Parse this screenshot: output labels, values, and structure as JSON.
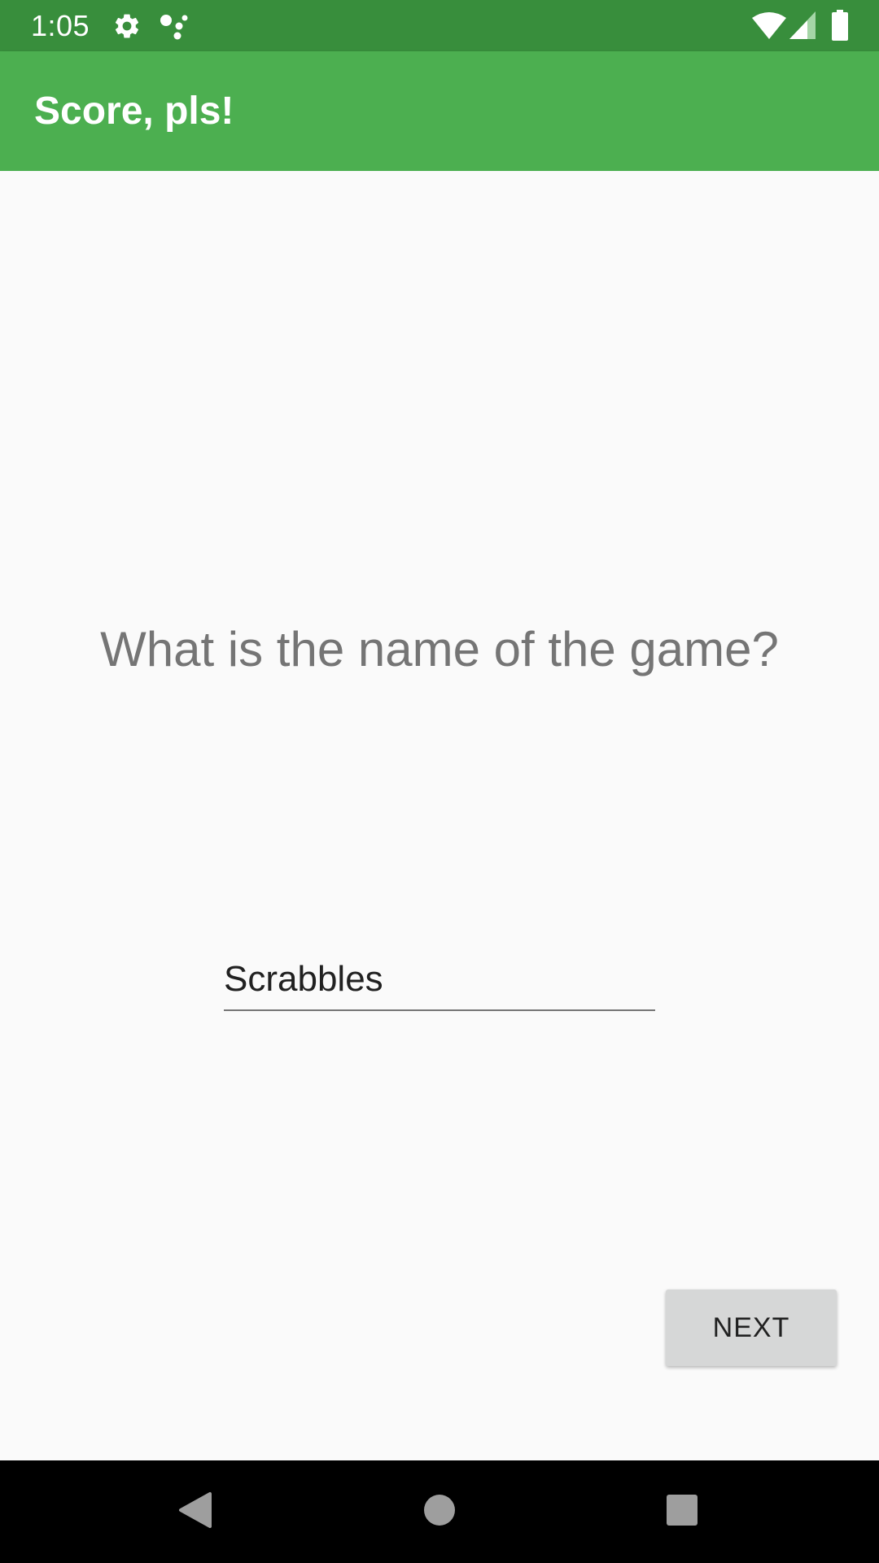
{
  "status_bar": {
    "time": "1:05",
    "icons": [
      "gear-icon",
      "assistant-dots-icon",
      "wifi-icon",
      "cell-signal-icon",
      "battery-icon"
    ]
  },
  "app_bar": {
    "title": "Score, pls!"
  },
  "main": {
    "question": "What is the name of the game?",
    "answer_value": "Scrabbles",
    "next_label": "NEXT"
  },
  "nav_bar": {
    "icons": [
      "back-icon",
      "home-icon",
      "recents-icon"
    ]
  },
  "colors": {
    "status_bar": "#388e3c",
    "app_bar": "#4caf50",
    "background": "#fafafa",
    "button": "#d6d7d7",
    "question_text": "#757575"
  }
}
